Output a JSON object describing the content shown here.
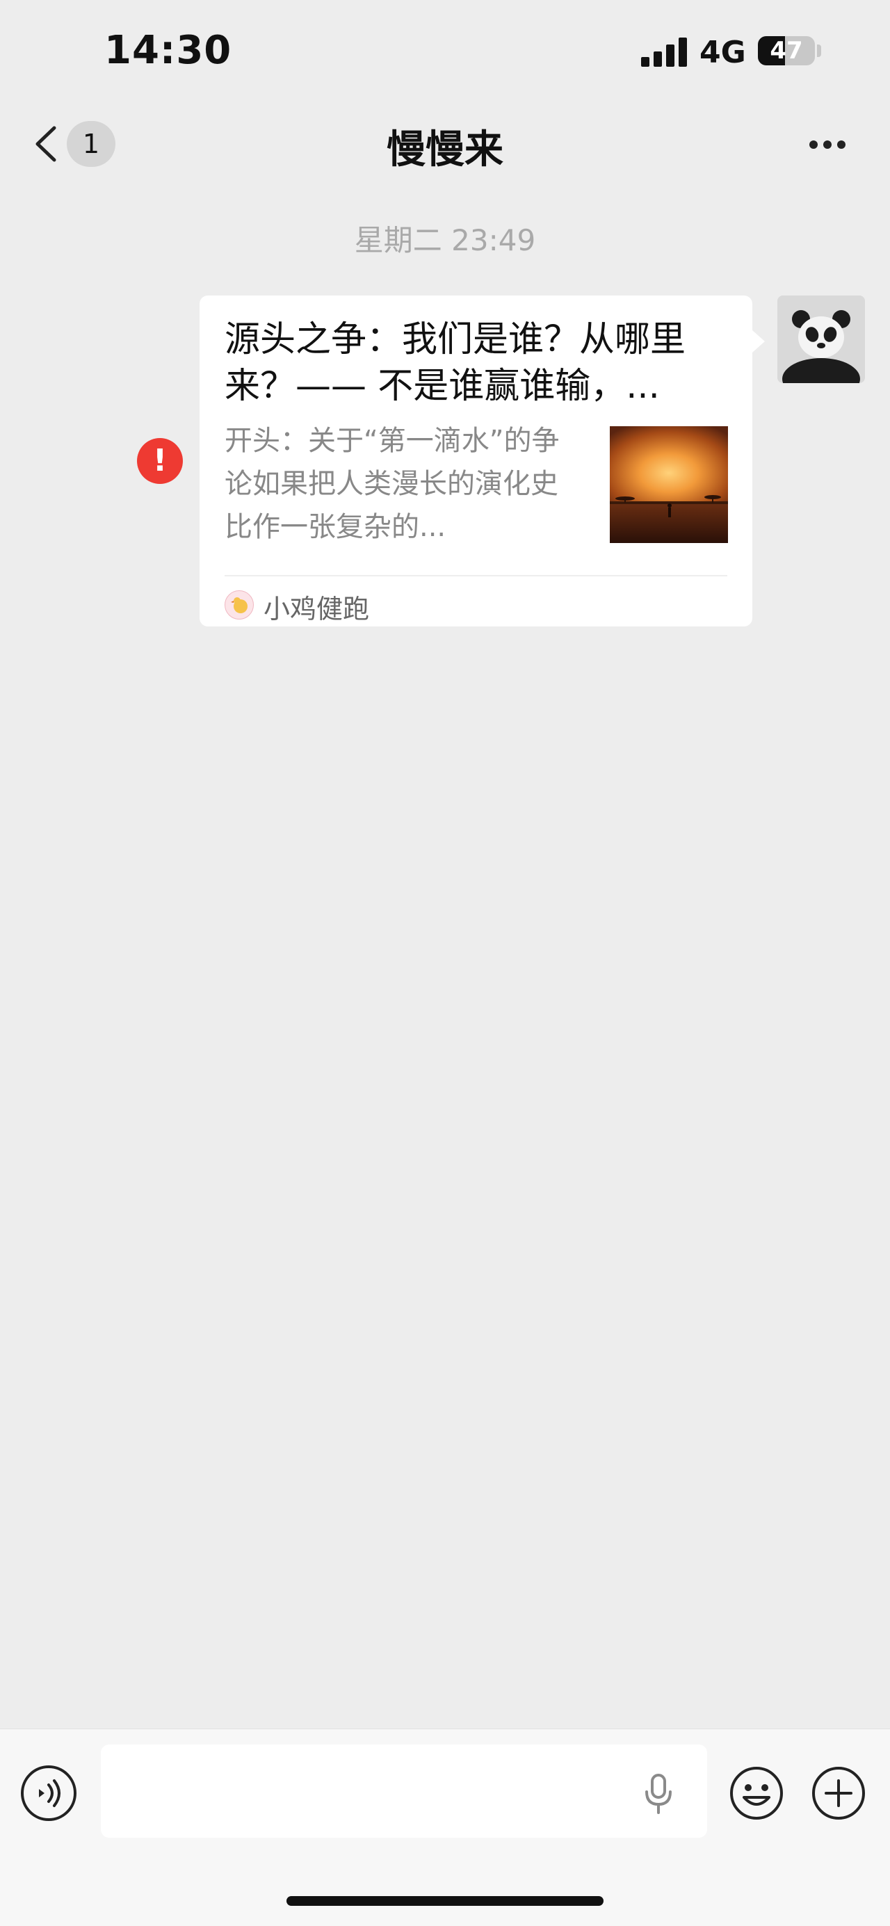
{
  "status_bar": {
    "time": "14:30",
    "network": "4G",
    "battery": "47",
    "battery_level": 0.47
  },
  "nav": {
    "unread_count": "1",
    "title": "慢慢来"
  },
  "chat": {
    "timestamp": "星期二 23:49",
    "message": {
      "error_mark": "!",
      "title": "源头之争：我们是谁？从哪里来？—— 不是谁赢谁输，...",
      "description": "开头：关于“第一滴水”的争论如果把人类漫长的演化史比作一张复杂的...",
      "source_name": "小鸡健跑"
    }
  },
  "icons": {
    "back": "chevron-left-icon",
    "more": "more-dots-icon",
    "error": "exclamation-icon",
    "voice": "voice-input-icon",
    "mic": "microphone-icon",
    "emoji": "emoji-icon",
    "plus": "plus-icon"
  },
  "colors": {
    "background": "#ededed",
    "error": "#ee3a32",
    "card": "#ffffff",
    "timestamp": "#a9a9a9"
  }
}
